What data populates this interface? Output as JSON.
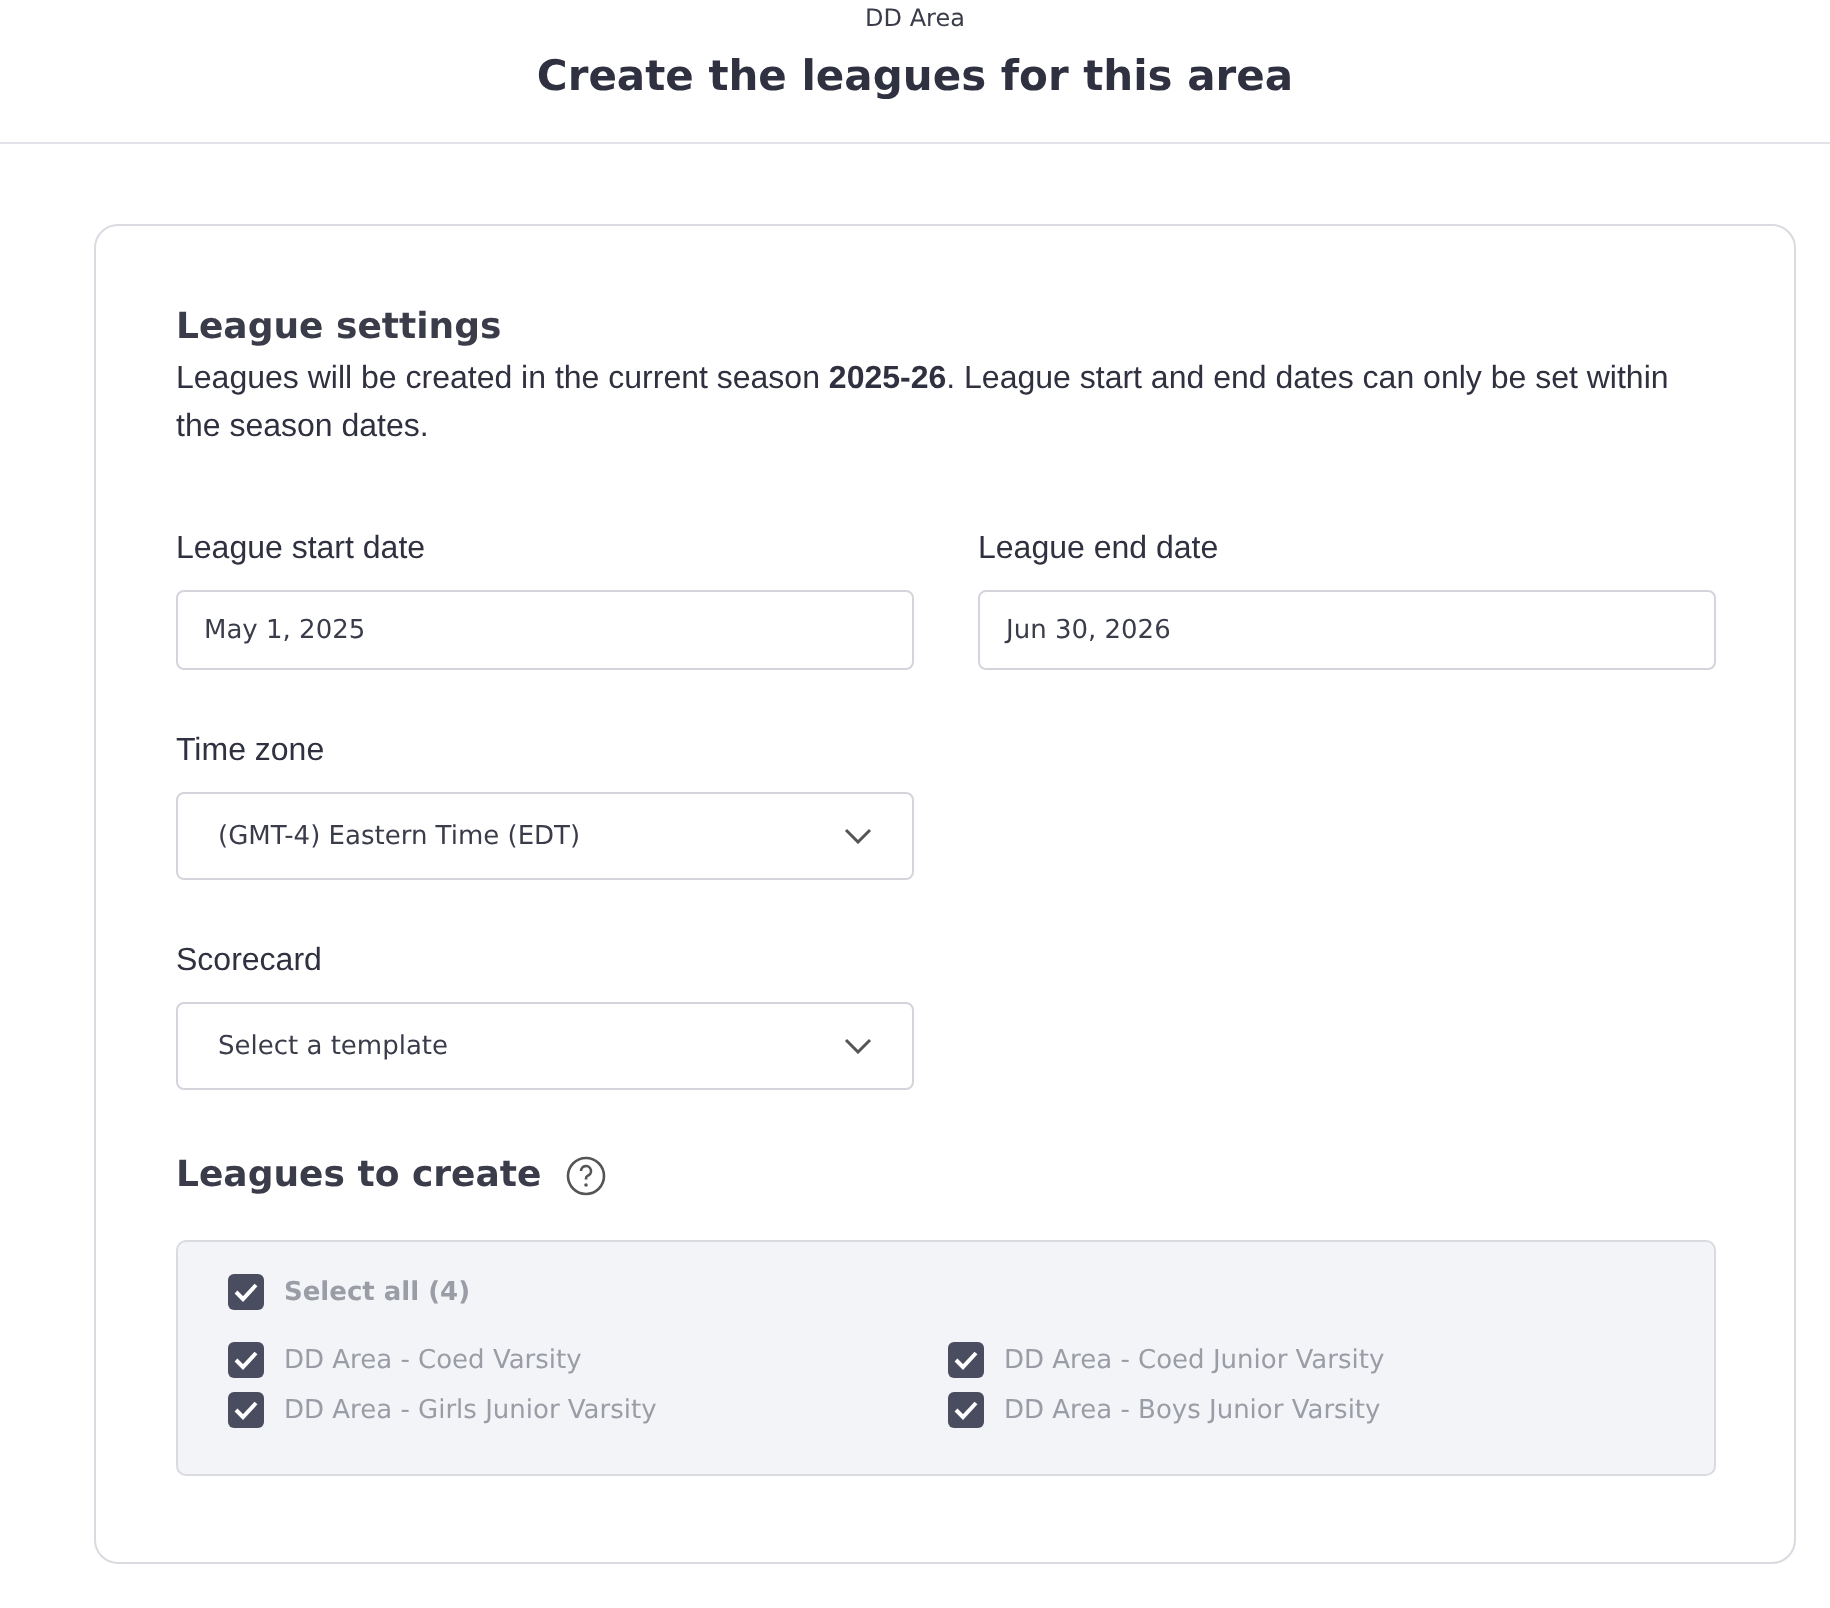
{
  "header": {
    "subtitle": "DD Area",
    "title": "Create the leagues for this area"
  },
  "settings": {
    "heading": "League settings",
    "description": "Leagues will be created in the current season **2025-26**. League start and end dates can only be set within the season dates.",
    "start_date": {
      "label": "League start date",
      "value": "May 1, 2025"
    },
    "end_date": {
      "label": "League end date",
      "value": "Jun 30, 2026"
    },
    "time_zone": {
      "label": "Time zone",
      "value": "(GMT-4) Eastern Time (EDT)"
    },
    "scorecard": {
      "label": "Scorecard",
      "placeholder": "Select a template"
    }
  },
  "leagues": {
    "heading": "Leagues to create",
    "disabled": true,
    "select_all": {
      "label": "Select all (4)",
      "checked": true
    },
    "items": [
      {
        "label": "DD Area - Coed Varsity",
        "checked": true
      },
      {
        "label": "DD Area - Coed Junior Varsity",
        "checked": true
      },
      {
        "label": "DD Area - Girls Junior Varsity",
        "checked": true
      },
      {
        "label": "DD Area - Boys Junior Varsity",
        "checked": true
      }
    ]
  }
}
